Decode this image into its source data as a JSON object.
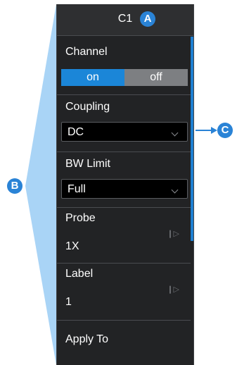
{
  "menu": {
    "title": "C1",
    "channel": {
      "label": "Channel",
      "on": "on",
      "off": "off",
      "state": "on"
    },
    "coupling": {
      "label": "Coupling",
      "value": "DC"
    },
    "bw_limit": {
      "label": "BW Limit",
      "value": "Full"
    },
    "probe": {
      "label": "Probe",
      "value": "1X"
    },
    "label_item": {
      "label": "Label",
      "value": "1"
    },
    "apply_to": {
      "label": "Apply To"
    }
  },
  "annotations": {
    "a": "A",
    "b": "B",
    "c": "C"
  },
  "icons": [
    "chevron-down-icon",
    "submenu-arrow-icon",
    "callout-arrow-icon"
  ],
  "colors": {
    "accent": "#1b86d8",
    "badge": "#2a83d6",
    "panel": "#222325",
    "wedge": "#a8d3f5"
  }
}
